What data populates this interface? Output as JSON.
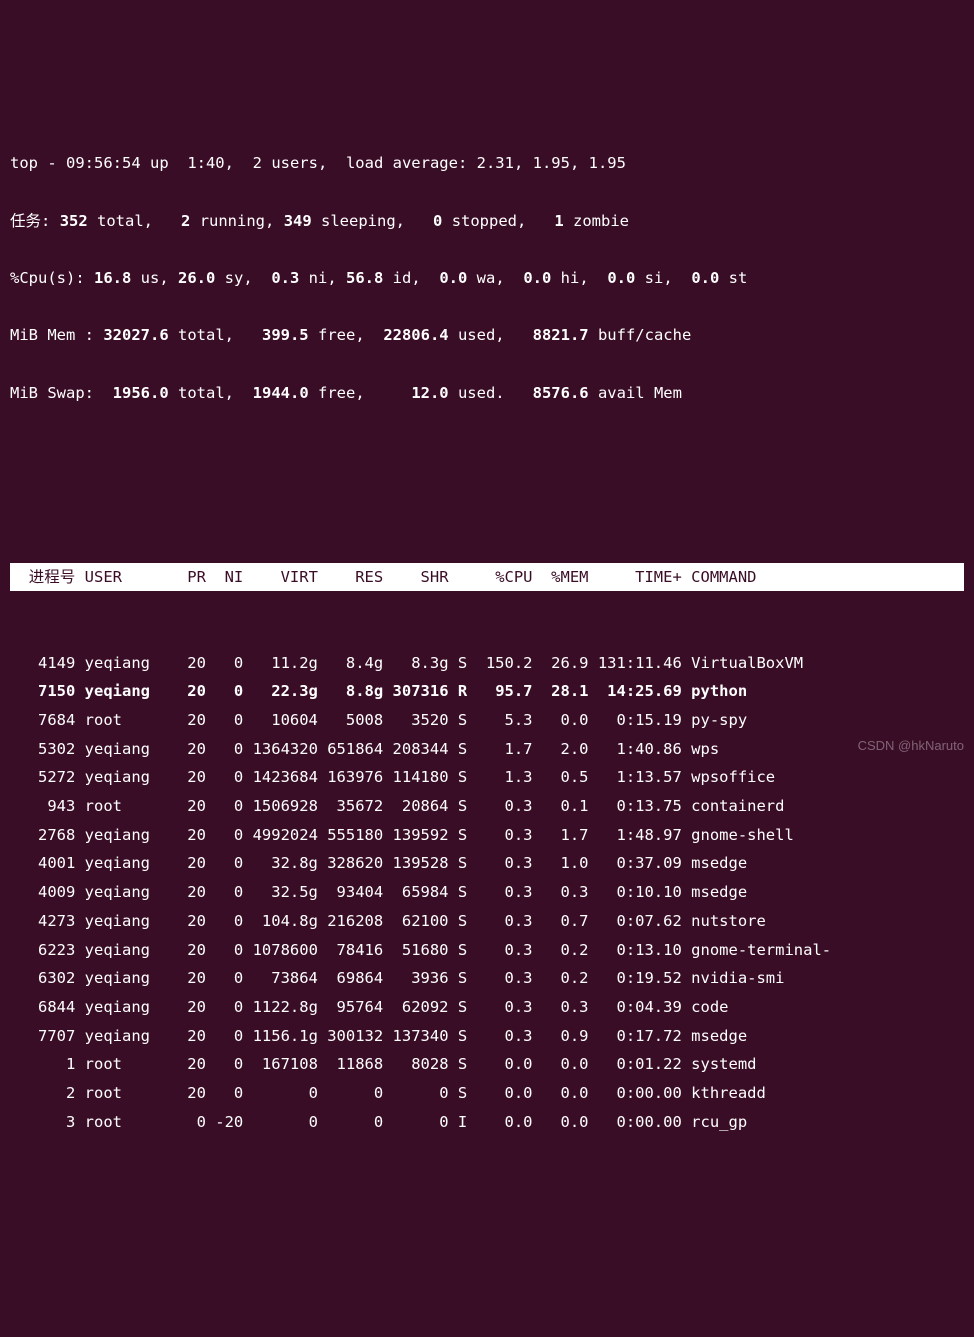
{
  "summary": {
    "line1_pre": "top - ",
    "time": "09:56:54",
    "uptime": " up  1:40,  ",
    "users": "2",
    "users_suffix": " users,  load average: ",
    "load": "2.31, 1.95, 1.95",
    "tasks_label": "任务:",
    "tasks_total": "352",
    "tasks_total_suffix": " total,   ",
    "tasks_running": "2",
    "tasks_running_suffix": " running, ",
    "tasks_sleeping": "349",
    "tasks_sleeping_suffix": " sleeping,   ",
    "tasks_stopped": "0",
    "tasks_stopped_suffix": " stopped,   ",
    "tasks_zombie": "1",
    "tasks_zombie_suffix": " zombie",
    "cpu_label": "%Cpu(s): ",
    "cpu_us": "16.8",
    "cpu_us_suffix": " us, ",
    "cpu_sy": "26.0",
    "cpu_sy_suffix": " sy,  ",
    "cpu_ni": "0.3",
    "cpu_ni_suffix": " ni, ",
    "cpu_id": "56.8",
    "cpu_id_suffix": " id,  ",
    "cpu_wa": "0.0",
    "cpu_wa_suffix": " wa,  ",
    "cpu_hi": "0.0",
    "cpu_hi_suffix": " hi,  ",
    "cpu_si": "0.0",
    "cpu_si_suffix": " si,  ",
    "cpu_st": "0.0",
    "cpu_st_suffix": " st",
    "mem_label": "MiB Mem : ",
    "mem_total": "32027.6",
    "mem_total_suffix": " total,   ",
    "mem_free": "399.5",
    "mem_free_suffix": " free,  ",
    "mem_used": "22806.4",
    "mem_used_suffix": " used,   ",
    "mem_buff": "8821.7",
    "mem_buff_suffix": " buff/cache",
    "swap_label": "MiB Swap:  ",
    "swap_total": "1956.0",
    "swap_total_suffix": " total,  ",
    "swap_free": "1944.0",
    "swap_free_suffix": " free,     ",
    "swap_used": "12.0",
    "swap_used_suffix": " used.   ",
    "swap_avail": "8576.6",
    "swap_avail_suffix": " avail Mem"
  },
  "columns": {
    "pid": " 进程号",
    "user": "USER",
    "pr": "PR",
    "ni": "NI",
    "virt": "VIRT",
    "res": "RES",
    "shr": "SHR",
    "s": "",
    "cpu": "%CPU",
    "mem": "%MEM",
    "time": "TIME+",
    "cmd": "COMMAND"
  },
  "rows": [
    {
      "pid": "4149",
      "user": "yeqiang",
      "pr": "20",
      "ni": "0",
      "virt": "11.2g",
      "res": "8.4g",
      "shr": "8.3g",
      "s": "S",
      "cpu": "150.2",
      "mem": "26.9",
      "time": "131:11.46",
      "cmd": "VirtualBoxVM",
      "bold": false
    },
    {
      "pid": "7150",
      "user": "yeqiang",
      "pr": "20",
      "ni": "0",
      "virt": "22.3g",
      "res": "8.8g",
      "shr": "307316",
      "s": "R",
      "cpu": "95.7",
      "mem": "28.1",
      "time": "14:25.69",
      "cmd": "python",
      "bold": true
    },
    {
      "pid": "7684",
      "user": "root",
      "pr": "20",
      "ni": "0",
      "virt": "10604",
      "res": "5008",
      "shr": "3520",
      "s": "S",
      "cpu": "5.3",
      "mem": "0.0",
      "time": "0:15.19",
      "cmd": "py-spy",
      "bold": false
    },
    {
      "pid": "5302",
      "user": "yeqiang",
      "pr": "20",
      "ni": "0",
      "virt": "1364320",
      "res": "651864",
      "shr": "208344",
      "s": "S",
      "cpu": "1.7",
      "mem": "2.0",
      "time": "1:40.86",
      "cmd": "wps",
      "bold": false
    },
    {
      "pid": "5272",
      "user": "yeqiang",
      "pr": "20",
      "ni": "0",
      "virt": "1423684",
      "res": "163976",
      "shr": "114180",
      "s": "S",
      "cpu": "1.3",
      "mem": "0.5",
      "time": "1:13.57",
      "cmd": "wpsoffice",
      "bold": false
    },
    {
      "pid": "943",
      "user": "root",
      "pr": "20",
      "ni": "0",
      "virt": "1506928",
      "res": "35672",
      "shr": "20864",
      "s": "S",
      "cpu": "0.3",
      "mem": "0.1",
      "time": "0:13.75",
      "cmd": "containerd",
      "bold": false
    },
    {
      "pid": "2768",
      "user": "yeqiang",
      "pr": "20",
      "ni": "0",
      "virt": "4992024",
      "res": "555180",
      "shr": "139592",
      "s": "S",
      "cpu": "0.3",
      "mem": "1.7",
      "time": "1:48.97",
      "cmd": "gnome-shell",
      "bold": false
    },
    {
      "pid": "4001",
      "user": "yeqiang",
      "pr": "20",
      "ni": "0",
      "virt": "32.8g",
      "res": "328620",
      "shr": "139528",
      "s": "S",
      "cpu": "0.3",
      "mem": "1.0",
      "time": "0:37.09",
      "cmd": "msedge",
      "bold": false
    },
    {
      "pid": "4009",
      "user": "yeqiang",
      "pr": "20",
      "ni": "0",
      "virt": "32.5g",
      "res": "93404",
      "shr": "65984",
      "s": "S",
      "cpu": "0.3",
      "mem": "0.3",
      "time": "0:10.10",
      "cmd": "msedge",
      "bold": false
    },
    {
      "pid": "4273",
      "user": "yeqiang",
      "pr": "20",
      "ni": "0",
      "virt": "104.8g",
      "res": "216208",
      "shr": "62100",
      "s": "S",
      "cpu": "0.3",
      "mem": "0.7",
      "time": "0:07.62",
      "cmd": "nutstore",
      "bold": false
    },
    {
      "pid": "6223",
      "user": "yeqiang",
      "pr": "20",
      "ni": "0",
      "virt": "1078600",
      "res": "78416",
      "shr": "51680",
      "s": "S",
      "cpu": "0.3",
      "mem": "0.2",
      "time": "0:13.10",
      "cmd": "gnome-terminal-",
      "bold": false
    },
    {
      "pid": "6302",
      "user": "yeqiang",
      "pr": "20",
      "ni": "0",
      "virt": "73864",
      "res": "69864",
      "shr": "3936",
      "s": "S",
      "cpu": "0.3",
      "mem": "0.2",
      "time": "0:19.52",
      "cmd": "nvidia-smi",
      "bold": false
    },
    {
      "pid": "6844",
      "user": "yeqiang",
      "pr": "20",
      "ni": "0",
      "virt": "1122.8g",
      "res": "95764",
      "shr": "62092",
      "s": "S",
      "cpu": "0.3",
      "mem": "0.3",
      "time": "0:04.39",
      "cmd": "code",
      "bold": false
    },
    {
      "pid": "7707",
      "user": "yeqiang",
      "pr": "20",
      "ni": "0",
      "virt": "1156.1g",
      "res": "300132",
      "shr": "137340",
      "s": "S",
      "cpu": "0.3",
      "mem": "0.9",
      "time": "0:17.72",
      "cmd": "msedge",
      "bold": false
    },
    {
      "pid": "1",
      "user": "root",
      "pr": "20",
      "ni": "0",
      "virt": "167108",
      "res": "11868",
      "shr": "8028",
      "s": "S",
      "cpu": "0.0",
      "mem": "0.0",
      "time": "0:01.22",
      "cmd": "systemd",
      "bold": false
    },
    {
      "pid": "2",
      "user": "root",
      "pr": "20",
      "ni": "0",
      "virt": "0",
      "res": "0",
      "shr": "0",
      "s": "S",
      "cpu": "0.0",
      "mem": "0.0",
      "time": "0:00.00",
      "cmd": "kthreadd",
      "bold": false
    },
    {
      "pid": "3",
      "user": "root",
      "pr": "0",
      "ni": "-20",
      "virt": "0",
      "res": "0",
      "shr": "0",
      "s": "I",
      "cpu": "0.0",
      "mem": "0.0",
      "time": "0:00.00",
      "cmd": "rcu_gp",
      "bold": false
    }
  ],
  "watermark": "CSDN @hkNaruto"
}
